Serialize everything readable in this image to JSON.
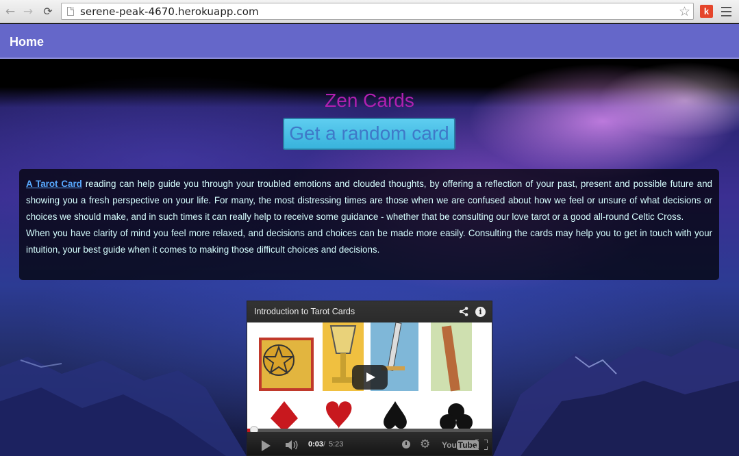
{
  "browser": {
    "url": "serene-peak-4670.herokuapp.com",
    "back_glyph": "←",
    "forward_glyph": "→",
    "reload_glyph": "⟳",
    "star_glyph": "☆",
    "extension_label": "k"
  },
  "navbar": {
    "home_label": "Home",
    "background": "#6567c9"
  },
  "main": {
    "title": "Zen Cards",
    "title_color": "#b020b0",
    "random_button_label": "Get a random card",
    "random_button_color": "#4ec1e8",
    "intro": {
      "link_text": "A Tarot Card",
      "paragraph1_rest": " reading can help guide you through your troubled emotions and clouded thoughts, by offering a reflection of your past, present and possible future and showing you a fresh perspective on your life. For many, the most distressing times are those when we are confused about how we feel or unsure of what decisions or choices we should make, and in such times it can really help to receive some guidance - whether that be consulting our love tarot or a good all-round Celtic Cross.",
      "paragraph2": "When you have clarity of mind you feel more relaxed, and decisions and choices can be made more easily. Consulting the cards may help you to get in touch with your intuition, your best guide when it comes to making those difficult choices and decisions."
    }
  },
  "video": {
    "title": "Introduction to Tarot Cards",
    "info_glyph": "i",
    "current_time": "0:03",
    "separator": "/",
    "duration": "5:23",
    "progress_fraction": 0.01,
    "youtube_label": "You",
    "youtube_label_box": "Tube",
    "gear_glyph": "⚙"
  }
}
